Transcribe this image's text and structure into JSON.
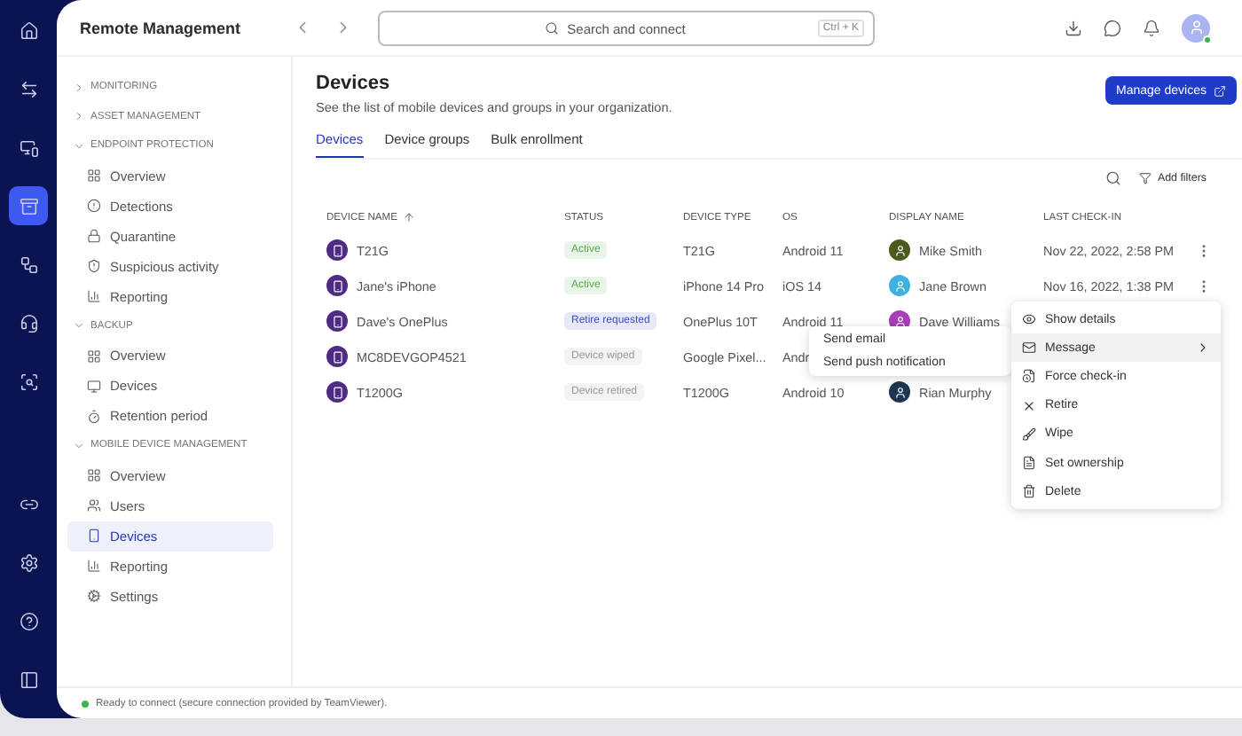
{
  "app": {
    "title": "Remote Management"
  },
  "search": {
    "placeholder": "Search and connect",
    "shortcut": "Ctrl + K"
  },
  "sidebar": {
    "sections": [
      {
        "title": "MONITORING",
        "expanded": false
      },
      {
        "title": "ASSET MANAGEMENT",
        "expanded": false
      },
      {
        "title": "ENDPOINT PROTECTION",
        "expanded": true,
        "items": [
          {
            "label": "Overview",
            "selected": false
          },
          {
            "label": "Detections",
            "selected": false
          },
          {
            "label": "Quarantine",
            "selected": false
          },
          {
            "label": "Suspicious activity",
            "selected": false
          },
          {
            "label": "Reporting",
            "selected": false
          }
        ]
      },
      {
        "title": "BACKUP",
        "expanded": true,
        "items": [
          {
            "label": "Overview",
            "selected": false
          },
          {
            "label": "Devices",
            "selected": false
          },
          {
            "label": "Retention period",
            "selected": false
          }
        ]
      },
      {
        "title": "MOBILE DEVICE MANAGEMENT",
        "expanded": true,
        "items": [
          {
            "label": "Overview",
            "selected": false
          },
          {
            "label": "Users",
            "selected": false
          },
          {
            "label": "Devices",
            "selected": true
          },
          {
            "label": "Reporting",
            "selected": false
          },
          {
            "label": "Settings",
            "selected": false
          }
        ]
      }
    ]
  },
  "page": {
    "title": "Devices",
    "subtitle": "See the list of mobile devices and groups in your organization.",
    "primary_button": "Manage devices"
  },
  "tabs": [
    {
      "label": "Devices",
      "selected": true
    },
    {
      "label": "Device groups",
      "selected": false
    },
    {
      "label": "Bulk enrollment",
      "selected": false
    }
  ],
  "toolbar": {
    "filter_button": "Add filters"
  },
  "table": {
    "columns": [
      "DEVICE NAME",
      "STATUS",
      "DEVICE TYPE",
      "OS",
      "DISPLAY NAME",
      "LAST CHECK-IN"
    ],
    "rows": [
      {
        "name": "T21G",
        "status": {
          "label": "Active",
          "color": "#55a94a"
        },
        "type": "T21G",
        "os": "Android 11",
        "user": {
          "name": "Mike Smith",
          "color": "#4a5a1c"
        },
        "last_check_in": "Nov 22, 2022, 2:58 PM",
        "actions_visible": true
      },
      {
        "name": "Jane's iPhone",
        "status": {
          "label": "Active",
          "color": "#55a94a"
        },
        "type": "iPhone 14 Pro",
        "os": "iOS 14",
        "user": {
          "name": "Jane Brown",
          "color": "#3fb0e0"
        },
        "last_check_in": "Nov 16, 2022, 1:38 PM",
        "actions_visible": true
      },
      {
        "name": "Dave's OnePlus",
        "status": {
          "label": "Retire requested",
          "color": "#3a4cc4"
        },
        "type": "OnePlus 10T",
        "os": "Android 11",
        "user": {
          "name": "Dave Williams",
          "color": "#a63fb8"
        },
        "actions_visible": false
      },
      {
        "name": "MC8DEVGOP4521",
        "status": {
          "label": "Device wiped",
          "color": "#999999"
        },
        "type": "Google Pixel...",
        "os": "Andr",
        "actions_visible": false
      },
      {
        "name": "T1200G",
        "status": {
          "label": "Device retired",
          "color": "#999999"
        },
        "type": "T1200G",
        "os": "Android 10",
        "user": {
          "name": "Rian Murphy",
          "color": "#1d3550"
        },
        "actions_visible": false
      }
    ]
  },
  "context_menu": {
    "items": [
      {
        "label": "Show details",
        "selected": false,
        "has_submenu": false
      },
      {
        "label": "Message",
        "selected": true,
        "has_submenu": true
      },
      {
        "label": "Force check-in",
        "selected": false,
        "has_submenu": false
      },
      {
        "label": "Retire",
        "selected": false,
        "has_submenu": false
      },
      {
        "label": "Wipe",
        "selected": false,
        "has_submenu": false
      },
      {
        "label": "Set ownership",
        "selected": false,
        "has_submenu": false
      },
      {
        "label": "Delete",
        "selected": false,
        "has_submenu": false
      }
    ],
    "submenu": [
      "Send email",
      "Send push notification"
    ]
  },
  "status_bar": {
    "text": "Ready to connect (secure connection provided by TeamViewer).",
    "connected": true
  }
}
